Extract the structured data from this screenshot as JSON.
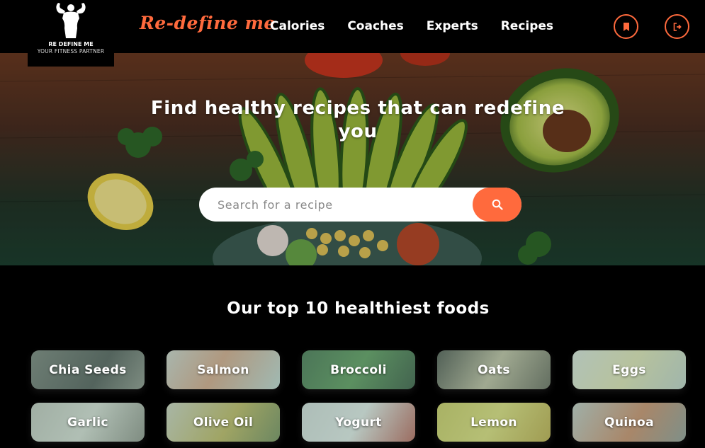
{
  "header": {
    "logo_title": "RE DEFINE ME",
    "logo_subtitle": "YOUR FITNESS PARTNER",
    "brand": "Re-define me",
    "nav": [
      "Calories",
      "Coaches",
      "Experts",
      "Recipes"
    ],
    "bookmark_icon": "bookmark-icon",
    "logout_icon": "logout-icon",
    "accent_color": "#ff6a3d"
  },
  "hero": {
    "title": "Find healthy recipes that can redefine you",
    "search_placeholder": "Search for a recipe",
    "search_icon": "search-icon"
  },
  "foods": {
    "title": "Our top 10 healthiest foods",
    "items": [
      "Chia Seeds",
      "Salmon",
      "Broccoli",
      "Oats",
      "Eggs",
      "Garlic",
      "Olive Oil",
      "Yogurt",
      "Lemon",
      "Quinoa"
    ]
  }
}
